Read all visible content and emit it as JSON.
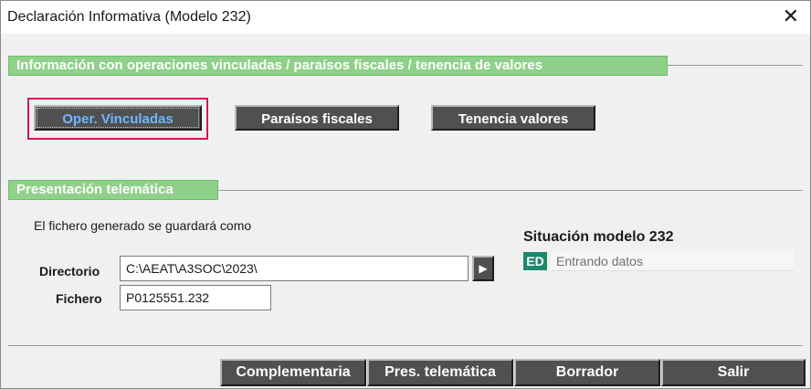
{
  "window": {
    "title": "Declaración Informativa (Modelo 232)"
  },
  "section_operaciones": {
    "title": "Información con operaciones vinculadas / paraísos fiscales / tenencia de valores",
    "buttons": [
      "Oper. Vinculadas",
      "Paraísos fiscales",
      "Tenencia valores"
    ]
  },
  "section_presentacion": {
    "title": "Presentación telemática",
    "note": "El fichero generado se guardará como",
    "directorio_label": "Directorio",
    "directorio_value": "C:\\AEAT\\A3SOC\\2023\\",
    "fichero_label": "Fichero",
    "fichero_value": "P0125551.232",
    "browse_glyph": "▶"
  },
  "situacion": {
    "title": "Situación modelo 232",
    "badge": "ED",
    "status": "Entrando datos",
    "badge_color": "#1b8a6f"
  },
  "bottom_buttons": [
    "Complementaria",
    "Pres. telemática",
    "Borrador",
    "Salir"
  ],
  "colors": {
    "section_green": "#8fd08a",
    "button_dark": "#505050",
    "focus": "#d0165e"
  }
}
